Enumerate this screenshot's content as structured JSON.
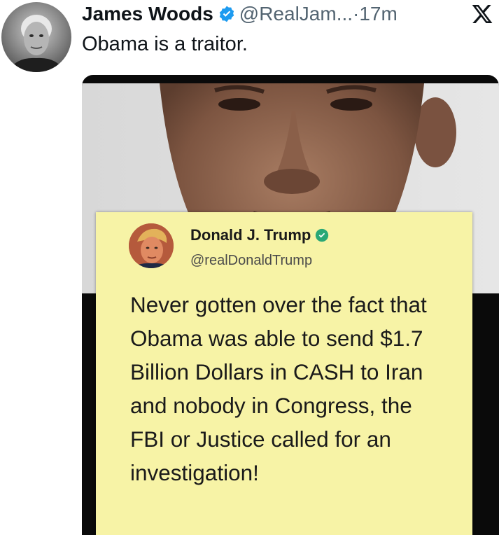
{
  "post": {
    "author": {
      "display_name": "James Woods",
      "handle": "@RealJam...",
      "separator": "·",
      "time": "17m",
      "verified_icon": "verified-badge-icon",
      "avatar": "avatar"
    },
    "platform_icon": "x-logo-icon",
    "text": "Obama is a traitor."
  },
  "media": {
    "quoted_note": {
      "author_name": "Donald J. Trump",
      "author_handle": "@realDonaldTrump",
      "verified_icon": "verified-badge-icon",
      "text": "Never gotten over the fact that Obama was able to send $1.7 Billion Dollars in CASH to Iran and nobody in Congress, the FBI or Justice called for an investigation!"
    }
  },
  "colors": {
    "text_primary": "#0f1419",
    "text_secondary": "#536471",
    "verified_blue": "#1d9bf0",
    "verified_green": "#2aa876",
    "note_background": "#f7f3a6"
  }
}
